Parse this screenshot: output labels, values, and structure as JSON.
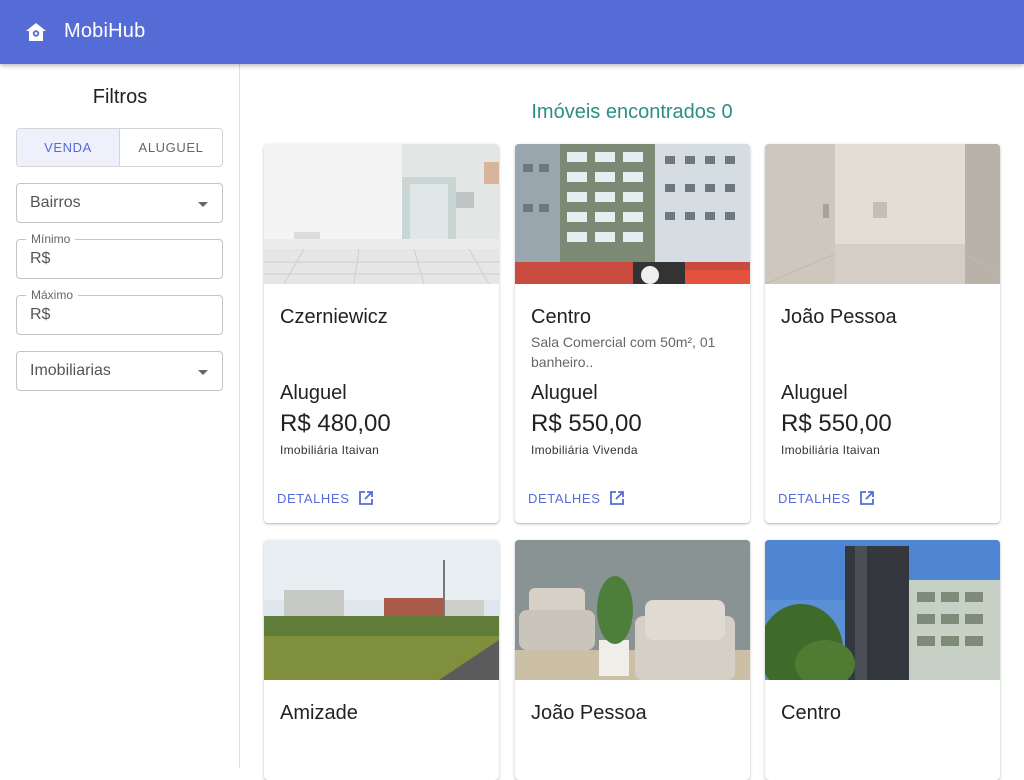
{
  "app": {
    "title": "MobiHub"
  },
  "sidebar": {
    "title": "Filtros",
    "toggle": [
      {
        "label": "VENDA",
        "active": true
      },
      {
        "label": "ALUGUEL",
        "active": false
      }
    ],
    "neighborhoods_placeholder": "Bairros",
    "min_label": "Mínimo",
    "min_value": "R$",
    "max_label": "Máximo",
    "max_value": "R$",
    "agencies_placeholder": "Imobiliarias"
  },
  "results": {
    "count_text": "Imóveis encontrados 0"
  },
  "cards": [
    {
      "title": "Czerniewicz",
      "description": "",
      "type": "Aluguel",
      "price": "R$ 480,00",
      "agency": "Imobiliária Itaivan",
      "link": "DETALHES",
      "photo": "empty-room"
    },
    {
      "title": "Centro",
      "description": "Sala Comercial com 50m², 01 banheiro..",
      "type": "Aluguel",
      "price": "R$ 550,00",
      "agency": "Imobiliária Vivenda",
      "link": "DETALHES",
      "photo": "apartment-building"
    },
    {
      "title": "João Pessoa",
      "description": "",
      "type": "Aluguel",
      "price": "R$ 550,00",
      "agency": "Imobiliária Itaivan",
      "link": "DETALHES",
      "photo": "beige-room"
    },
    {
      "title": "Amizade",
      "description": "",
      "type": "",
      "price": "",
      "agency": "",
      "link": "",
      "photo": "empty-lot"
    },
    {
      "title": "João Pessoa",
      "description": "",
      "type": "",
      "price": "",
      "agency": "",
      "link": "",
      "photo": "lounge-armchairs"
    },
    {
      "title": "Centro",
      "description": "",
      "type": "",
      "price": "",
      "agency": "",
      "link": "",
      "photo": "office-building"
    }
  ],
  "colors": {
    "primary": "#556CD6",
    "accent_text": "#2a8f85"
  }
}
